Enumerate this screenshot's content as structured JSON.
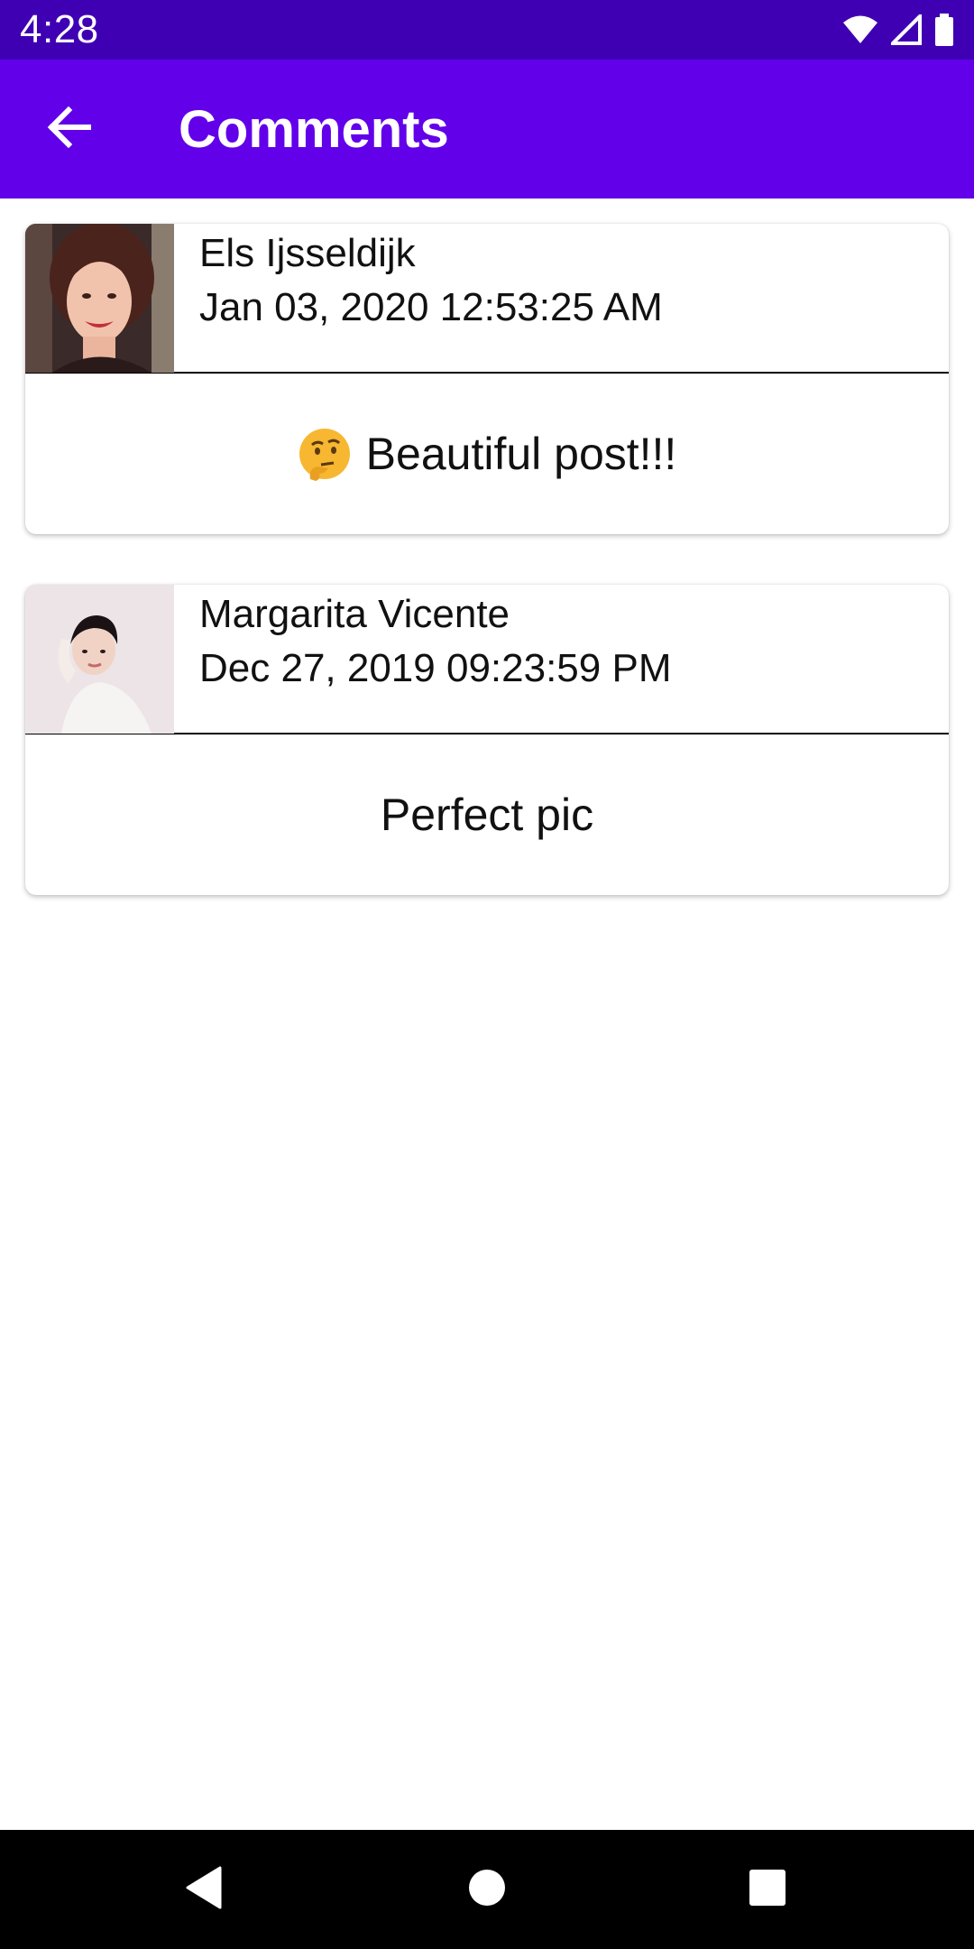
{
  "status_bar": {
    "time": "4:28",
    "icons": [
      "wifi-icon",
      "cellular-signal-icon",
      "battery-icon"
    ]
  },
  "app_bar": {
    "title": "Comments",
    "back_icon": "arrow-back-icon",
    "background_color": "#6200ea"
  },
  "comments": [
    {
      "author": "Els Ijsseldijk",
      "timestamp": "Jan 03, 2020 12:53:25 AM",
      "emoji": "thinking-face-emoji",
      "text": "Beautiful post!!!"
    },
    {
      "author": "Margarita Vicente",
      "timestamp": "Dec 27, 2019 09:23:59 PM",
      "text": "Perfect pic"
    }
  ],
  "nav_bar": {
    "buttons": [
      "back-triangle-icon",
      "home-circle-icon",
      "recents-square-icon"
    ]
  }
}
